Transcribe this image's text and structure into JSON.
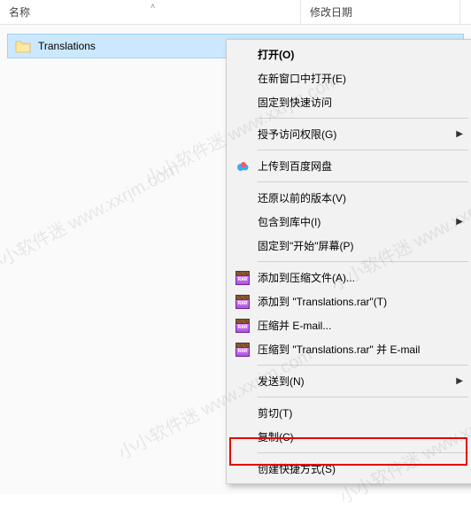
{
  "header": {
    "name_col": "名称",
    "date_col": "修改日期"
  },
  "file": {
    "name": "Translations"
  },
  "menu": {
    "open": "打开(O)",
    "open_new_window": "在新窗口中打开(E)",
    "pin_quick_access": "固定到快速访问",
    "grant_access": "授予访问权限(G)",
    "upload_baidu": "上传到百度网盘",
    "restore_versions": "还原以前的版本(V)",
    "include_library": "包含到库中(I)",
    "pin_start": "固定到\"开始\"屏幕(P)",
    "add_archive": "添加到压缩文件(A)...",
    "add_rar": "添加到 \"Translations.rar\"(T)",
    "compress_email": "压缩并 E-mail...",
    "compress_rar_email": "压缩到 \"Translations.rar\" 并 E-mail",
    "send_to": "发送到(N)",
    "cut": "剪切(T)",
    "copy": "复制(C)",
    "create_shortcut": "创建快捷方式(S)"
  },
  "watermark": "小小软件迷 www.xxrjm.com"
}
